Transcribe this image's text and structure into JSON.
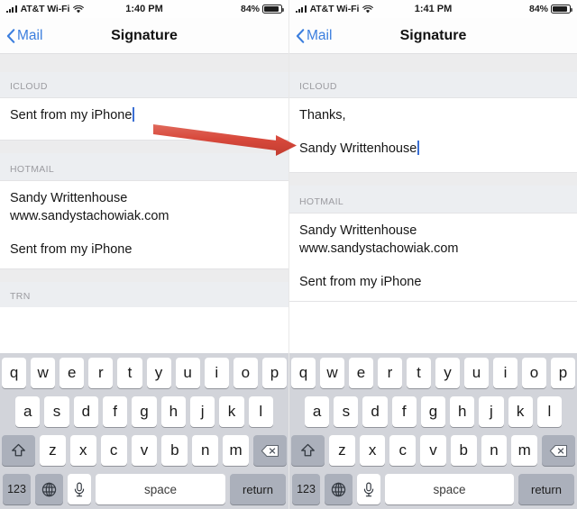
{
  "panels": [
    {
      "id": "before",
      "status": {
        "carrier": "AT&T Wi-Fi",
        "time": "1:40 PM",
        "battery_pct": "84%",
        "signal_icon": "signal-bars-icon",
        "wifi_icon": "wifi-icon",
        "battery_icon": "battery-icon"
      },
      "nav": {
        "back_label": "Mail",
        "back_icon": "chevron-left-icon",
        "title": "Signature"
      },
      "sections": [
        {
          "header": "ICLOUD",
          "lines": [
            "Sent from my iPhone"
          ],
          "caret_after_line": 0
        },
        {
          "header": "HOTMAIL",
          "lines": [
            "Sandy Writtenhouse",
            "www.sandystachowiak.com",
            "",
            "Sent from my iPhone"
          ],
          "caret_after_line": -1
        },
        {
          "header": "TRN",
          "lines": [],
          "caret_after_line": -1
        }
      ]
    },
    {
      "id": "after",
      "status": {
        "carrier": "AT&T Wi-Fi",
        "time": "1:41 PM",
        "battery_pct": "84%",
        "signal_icon": "signal-bars-icon",
        "wifi_icon": "wifi-icon",
        "battery_icon": "battery-icon"
      },
      "nav": {
        "back_label": "Mail",
        "back_icon": "chevron-left-icon",
        "title": "Signature"
      },
      "sections": [
        {
          "header": "ICLOUD",
          "lines": [
            "Thanks,",
            "",
            "Sandy Writtenhouse"
          ],
          "caret_after_line": 2
        },
        {
          "header": "HOTMAIL",
          "lines": [
            "Sandy Writtenhouse",
            "www.sandystachowiak.com",
            "",
            "Sent from my iPhone"
          ],
          "caret_after_line": -1
        }
      ]
    }
  ],
  "keyboard": {
    "row1": [
      "q",
      "w",
      "e",
      "r",
      "t",
      "y",
      "u",
      "i",
      "o",
      "p"
    ],
    "row2": [
      "a",
      "s",
      "d",
      "f",
      "g",
      "h",
      "j",
      "k",
      "l"
    ],
    "row3": [
      "z",
      "x",
      "c",
      "v",
      "b",
      "n",
      "m"
    ],
    "shift_icon": "shift-arrow-icon",
    "delete_icon": "backspace-delete-icon",
    "numbers_label": "123",
    "globe_icon": "globe-language-icon",
    "mic_icon": "microphone-icon",
    "space_label": "space",
    "return_label": "return"
  },
  "annotation": {
    "arrow_icon": "red-arrow-right",
    "arrow_color": "#d84f42"
  }
}
